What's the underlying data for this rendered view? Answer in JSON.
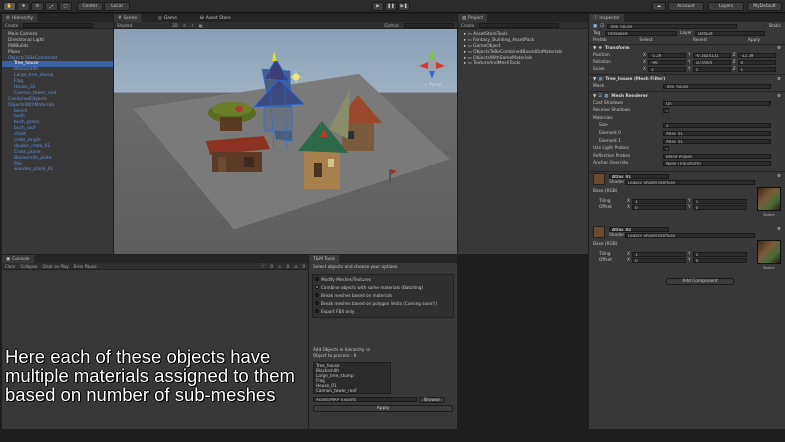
{
  "toolbar": {
    "left_buttons": [
      "hand-tool",
      "move-tool",
      "rotate-tool",
      "scale-tool",
      "rect-tool"
    ],
    "pivot": "Center",
    "space": "Local",
    "account": "Account",
    "layers": "Layers",
    "layout": "MyDefault"
  },
  "hierarchy": {
    "tab": "Hierarchy",
    "create": "Create",
    "search_placeholder": "Q-All",
    "items": [
      {
        "label": "Main Camera",
        "style": "normal",
        "indent": 0
      },
      {
        "label": "Directional Light",
        "style": "normal",
        "indent": 0
      },
      {
        "label": "RWBuilds",
        "style": "normal",
        "indent": 0
      },
      {
        "label": "Plane",
        "style": "normal",
        "indent": 0
      },
      {
        "label": "ObjectsToBeCombined",
        "style": "blue",
        "indent": 0
      },
      {
        "label": "Tree_house",
        "style": "selected",
        "indent": 1
      },
      {
        "label": "Blacksmith",
        "style": "blue",
        "indent": 1
      },
      {
        "label": "Large_tree_stump",
        "style": "blue",
        "indent": 1
      },
      {
        "label": "Flag",
        "style": "blue",
        "indent": 1
      },
      {
        "label": "House_01",
        "style": "blue",
        "indent": 1
      },
      {
        "label": "Cannon_tower_roof",
        "style": "blue",
        "indent": 1
      },
      {
        "label": "CombinedObjects",
        "style": "blue",
        "indent": 0
      },
      {
        "label": "ObjectsWithMaterials",
        "style": "blue",
        "indent": 0
      },
      {
        "label": "bench",
        "style": "blue",
        "indent": 1
      },
      {
        "label": "bush",
        "style": "blue",
        "indent": 1
      },
      {
        "label": "bush_green",
        "style": "blue",
        "indent": 1
      },
      {
        "label": "bush_roof",
        "style": "blue",
        "indent": 1
      },
      {
        "label": "chest",
        "style": "blue",
        "indent": 1
      },
      {
        "label": "crate_single",
        "style": "blue",
        "indent": 1
      },
      {
        "label": "double_crate_01",
        "style": "blue",
        "indent": 1
      },
      {
        "label": "Cross_plane",
        "style": "blue",
        "indent": 1
      },
      {
        "label": "Blacksmith_plate",
        "style": "blue",
        "indent": 1
      },
      {
        "label": "Pile",
        "style": "blue",
        "indent": 1
      },
      {
        "label": "wooden_plank_01",
        "style": "blue",
        "indent": 1
      }
    ]
  },
  "scene": {
    "tabs": [
      "Scene",
      "Game",
      "Asset Store"
    ],
    "shading": "Shaded",
    "mode_2d": "2D",
    "gizmos": "Gizmos",
    "search_placeholder": "Q-All",
    "view_label": "< Persp"
  },
  "project": {
    "tab": "Project",
    "create": "Create",
    "folders": [
      "AssetStoreTools",
      "Fantasy_Building_AssetPack",
      "GameObject",
      "ObjectsToBeCombinedBasedOnMaterials",
      "ObjectsWithSameMaterials",
      "TextureAndMeshTools"
    ]
  },
  "inspector": {
    "tab": "Inspector",
    "object_name": "Tree_house",
    "static": "Static",
    "tag_label": "Tag",
    "tag_value": "Untagged",
    "layer_label": "Layer",
    "layer_value": "Default",
    "prefab_label": "Prefab",
    "prefab_buttons": [
      "Select",
      "Revert",
      "Apply"
    ],
    "transform": {
      "title": "Transform",
      "position_label": "Position",
      "position": [
        "-5.29",
        "-0.1824131",
        "-12.39"
      ],
      "rotation_label": "Rotation",
      "rotation": [
        "-90",
        "10.0004",
        "0"
      ],
      "scale_label": "Scale",
      "scale": [
        "1",
        "1",
        "1"
      ]
    },
    "mesh_filter": {
      "title": "Tree_house (Mesh Filter)",
      "mesh_label": "Mesh",
      "mesh_value": "Tree_house"
    },
    "mesh_renderer": {
      "title": "Mesh Renderer",
      "rows": [
        {
          "label": "Cast Shadows",
          "value": "On"
        },
        {
          "label": "Receive Shadows",
          "value": "✓"
        },
        {
          "label": "Materials",
          "value": ""
        },
        {
          "label": "Size",
          "value": "2"
        },
        {
          "label": "Element 0",
          "value": "Atlas_01"
        },
        {
          "label": "Element 1",
          "value": "Atlas_01"
        },
        {
          "label": "Use Light Probes",
          "value": "✓"
        },
        {
          "label": "Reflection Probes",
          "value": "Blend Probes"
        },
        {
          "label": "Anchor Override",
          "value": "None (Transform)"
        }
      ]
    },
    "materials": [
      {
        "name": "Atlas_01",
        "shader_label": "Shader",
        "shader": "Legacy Shaders/Diffuse",
        "base_label": "Base (RGB)",
        "tiling_label": "Tiling",
        "offset_label": "Offset",
        "tiling": [
          "1",
          "1"
        ],
        "offset": [
          "0",
          "0"
        ],
        "select": "Select"
      },
      {
        "name": "Atlas_02",
        "shader_label": "Shader",
        "shader": "Legacy Shaders/Diffuse",
        "base_label": "Base (RGB)",
        "tiling_label": "Tiling",
        "offset_label": "Offset",
        "tiling": [
          "1",
          "1"
        ],
        "offset": [
          "0",
          "0"
        ],
        "select": "Select"
      }
    ],
    "add_component": "Add Component"
  },
  "console": {
    "tab": "Console",
    "buttons": [
      "Clear",
      "Collapse",
      "Clear on Play",
      "Error Pause"
    ],
    "counts": [
      "0",
      "0",
      "0"
    ]
  },
  "tmtools": {
    "tab": "T&M Tools",
    "heading": "Select objects and choose your options",
    "options": [
      {
        "label": "Modify Meshes/Textures",
        "selected": false
      },
      {
        "label": "Combine objects with same materials (Batching)",
        "selected": true
      },
      {
        "label": "Break meshes based on materials",
        "selected": false
      },
      {
        "label": "Break meshes based on polygon limits (Coming soon!!)",
        "selected": false
      },
      {
        "label": "Export FBX only",
        "selected": false
      }
    ],
    "add_objects_label": "Add Objects in hierarchy",
    "process_label": "Object to process : 6",
    "objects": [
      "Tree_house",
      "Blacksmith",
      "Large_tree_stump",
      "Flag",
      "House_01",
      "Cannon_tower_roof"
    ],
    "path": "Assets/MRP_Exports",
    "browse": "Browse",
    "apply": "Apply"
  },
  "caption": {
    "lines": [
      "Here each of these objects have",
      "multiple materials assigned to them",
      "based on number of sub-meshes"
    ]
  }
}
